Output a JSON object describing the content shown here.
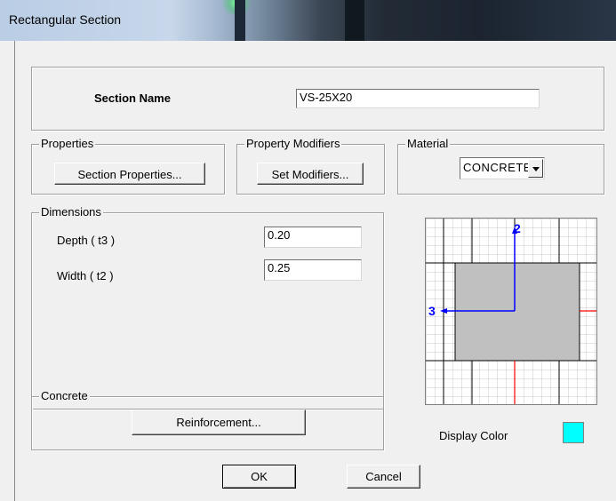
{
  "window": {
    "title": "Rectangular Section"
  },
  "section_name": {
    "label": "Section Name",
    "value": "VS-25X20"
  },
  "properties": {
    "legend": "Properties",
    "button": "Section Properties..."
  },
  "modifiers": {
    "legend": "Property Modifiers",
    "button": "Set Modifiers..."
  },
  "material": {
    "legend": "Material",
    "selected": "CONCRETE"
  },
  "dimensions": {
    "legend": "Dimensions",
    "depth_label": "Depth ( t3 )",
    "depth_value": "0.20",
    "width_label": "Width ( t2 )",
    "width_value": "0.25"
  },
  "preview": {
    "axis_2": "2",
    "axis_3": "3"
  },
  "concrete": {
    "legend": "Concrete",
    "button": "Reinforcement..."
  },
  "display_color": {
    "label": "Display Color",
    "color": "#00ffff"
  },
  "actions": {
    "ok": "OK",
    "cancel": "Cancel"
  },
  "colors": {
    "section_fill": "#c0c0c0",
    "axis_blue": "#0000ff",
    "axis_red": "#ff0000"
  }
}
